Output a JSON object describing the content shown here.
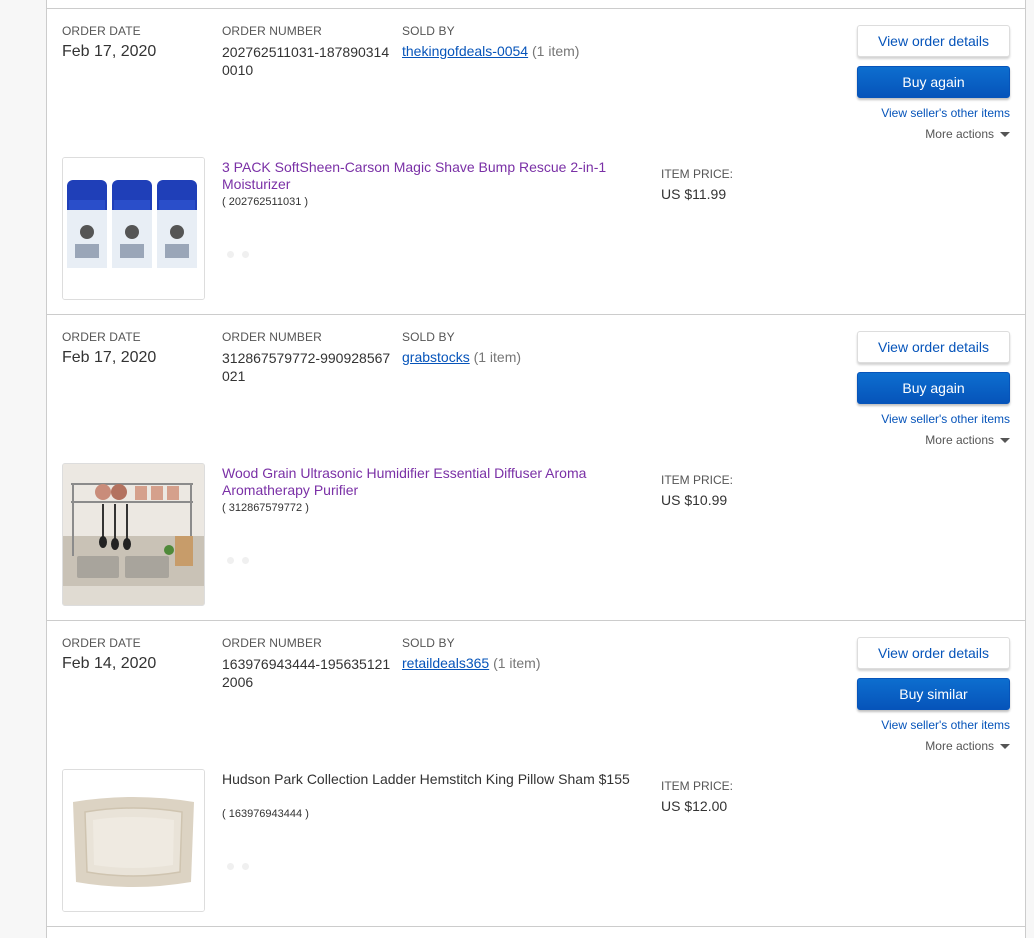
{
  "labels": {
    "order_date": "ORDER DATE",
    "order_number": "ORDER NUMBER",
    "sold_by": "SOLD BY",
    "item_price": "ITEM PRICE:",
    "view_order_details": "View order details",
    "view_seller_items": "View seller's other items",
    "more_actions": "More actions"
  },
  "orders": [
    {
      "date": "Feb 17, 2020",
      "number": "202762511031-1878903140010",
      "seller": "thekingofdeals-0054",
      "item_count": "(1 item)",
      "primary_action": "Buy again",
      "item_title": "3 PACK SoftSheen-Carson Magic Shave Bump Rescue 2-in-1 Moisturizer",
      "item_id": "( 202762511031 )",
      "price": "US $11.99",
      "thumbnail": "shave-moisturizer-3pack-image"
    },
    {
      "date": "Feb 17, 2020",
      "number": "312867579772-990928567021",
      "seller": "grabstocks",
      "item_count": "(1 item)",
      "primary_action": "Buy again",
      "item_title": "Wood Grain Ultrasonic Humidifier Essential Diffuser Aroma Aromatherapy Purifier",
      "item_id": "( 312867579772 )",
      "price": "US $10.99",
      "thumbnail": "kitchen-dish-rack-image"
    },
    {
      "date": "Feb 14, 2020",
      "number": "163976943444-1956351212006",
      "seller": "retaildeals365",
      "item_count": "(1 item)",
      "primary_action": "Buy similar",
      "item_title": "Hudson Park Collection Ladder Hemstitch King Pillow Sham $155",
      "item_id": "( 163976943444 )",
      "price": "US $12.00",
      "thumbnail": "pillow-sham-image"
    }
  ],
  "colors": {
    "link": "#0654ba",
    "visited": "#7a30a6",
    "primary_button": "#0654ba",
    "border": "#cccccc"
  }
}
